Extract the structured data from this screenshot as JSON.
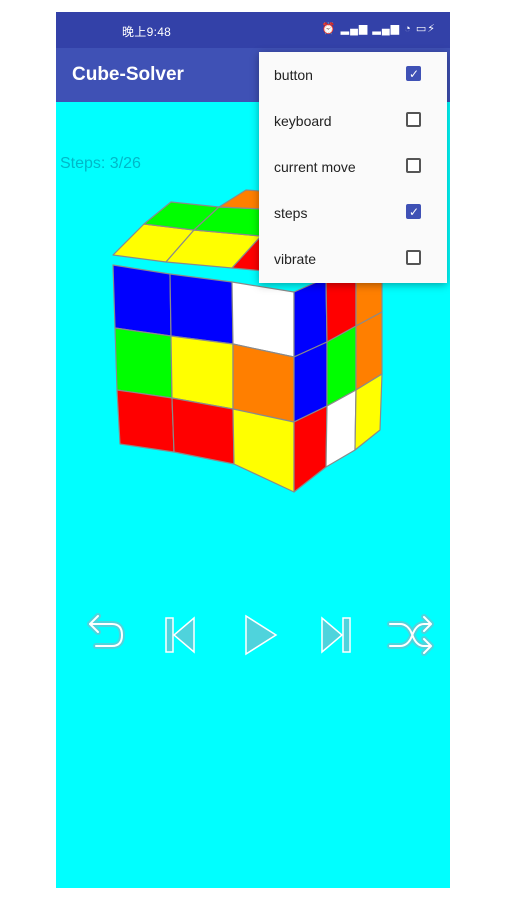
{
  "status_bar": {
    "time": "晚上9:48",
    "icons_text": "⏰ ▂▄▆ ▂▄▆ ◔ ▭⚡"
  },
  "app_bar": {
    "title": "Cube-Solver"
  },
  "main": {
    "steps_text": "Steps: 3/26"
  },
  "controls": [
    {
      "name": "undo",
      "icon": "undo-icon"
    },
    {
      "name": "previous",
      "icon": "skip-previous-icon"
    },
    {
      "name": "play",
      "icon": "play-icon"
    },
    {
      "name": "next",
      "icon": "skip-next-icon"
    },
    {
      "name": "shuffle",
      "icon": "shuffle-icon"
    }
  ],
  "menu": {
    "items": [
      {
        "label": "button",
        "checked": true
      },
      {
        "label": "keyboard",
        "checked": false
      },
      {
        "label": "current move",
        "checked": false
      },
      {
        "label": "steps",
        "checked": true
      },
      {
        "label": "vibrate",
        "checked": false
      }
    ]
  },
  "colors": {
    "background": "#00ffff",
    "appbar": "#3f51b5",
    "statusbar": "#3341a8",
    "accent": "#3f51b5",
    "cube_red": "#ff0000",
    "cube_green": "#00ff00",
    "cube_blue": "#0000ff",
    "cube_yellow": "#ffff00",
    "cube_orange": "#ff7f00",
    "cube_white": "#ffffff"
  }
}
